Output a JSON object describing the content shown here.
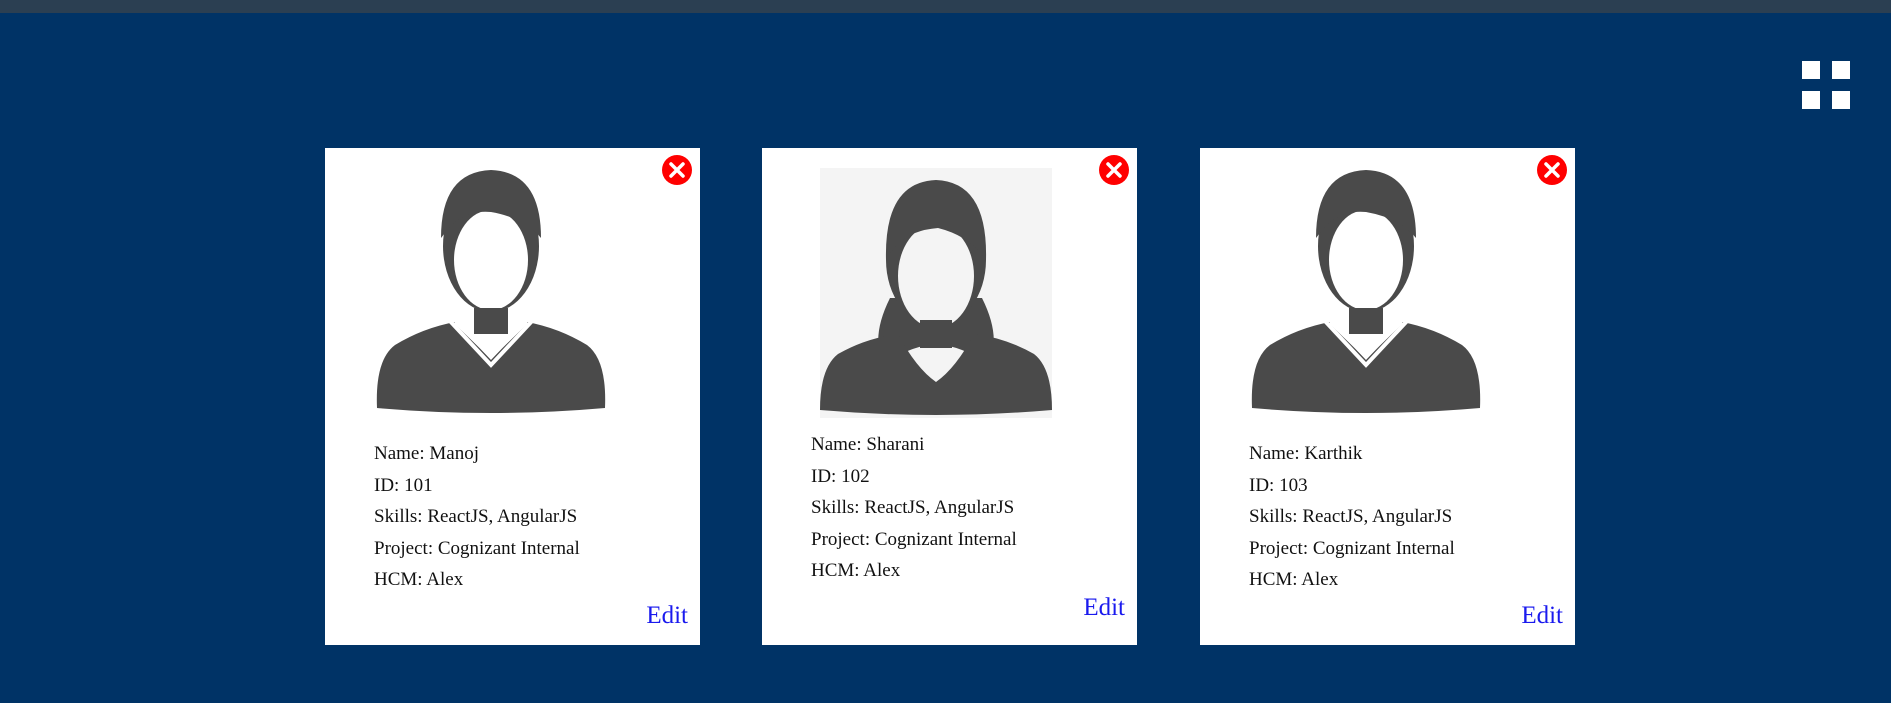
{
  "colors": {
    "background": "#003366",
    "top_bar": "#2b3f52",
    "card": "#ffffff",
    "delete": "#ff0000",
    "edit_link": "#1a1aee",
    "avatar": "#4a4a4a"
  },
  "toolbar": {
    "view_toggle_icon": "grid-view-icon"
  },
  "employees": [
    {
      "avatar": "male-avatar-icon",
      "name_label": "Name: Manoj",
      "id_label": "ID: 101",
      "skills_label": "Skills: ReactJS, AngularJS",
      "project_label": "Project: Cognizant Internal",
      "hcm_label": "HCM: Alex",
      "edit_label": "Edit"
    },
    {
      "avatar": "female-avatar-icon",
      "name_label": "Name: Sharani",
      "id_label": "ID: 102",
      "skills_label": "Skills: ReactJS, AngularJS",
      "project_label": "Project: Cognizant Internal",
      "hcm_label": "HCM: Alex",
      "edit_label": "Edit"
    },
    {
      "avatar": "male-avatar-icon",
      "name_label": "Name: Karthik",
      "id_label": "ID: 103",
      "skills_label": "Skills: ReactJS, AngularJS",
      "project_label": "Project: Cognizant Internal",
      "hcm_label": "HCM: Alex",
      "edit_label": "Edit"
    }
  ]
}
